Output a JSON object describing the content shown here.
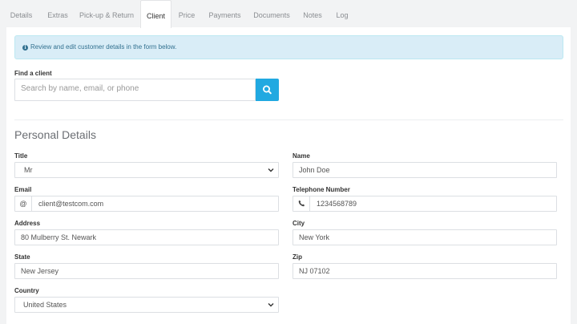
{
  "tabs": [
    {
      "label": "Details",
      "active": false
    },
    {
      "label": "Extras",
      "active": false
    },
    {
      "label": "Pick-up & Return",
      "active": false
    },
    {
      "label": "Client",
      "active": true
    },
    {
      "label": "Price",
      "active": false
    },
    {
      "label": "Payments",
      "active": false
    },
    {
      "label": "Documents",
      "active": false
    },
    {
      "label": "Notes",
      "active": false
    },
    {
      "label": "Log",
      "active": false
    }
  ],
  "alert": {
    "icon": "info-circle-icon",
    "text": "Review and edit customer details in the form below."
  },
  "find_client": {
    "label": "Find a client",
    "placeholder": "Search by name, email, or phone",
    "button_icon": "search-icon"
  },
  "personal_details": {
    "title": "Personal Details",
    "title_field": {
      "label": "Title",
      "value": "Mr"
    },
    "name": {
      "label": "Name",
      "value": "John Doe"
    },
    "email": {
      "label": "Email",
      "addon": "@",
      "value": "client@testcom.com"
    },
    "telephone": {
      "label": "Telephone Number",
      "addon_icon": "phone-icon",
      "value": "1234568789"
    },
    "address": {
      "label": "Address",
      "value": "80 Mulberry St. Newark"
    },
    "city": {
      "label": "City",
      "value": "New York"
    },
    "state": {
      "label": "State",
      "value": "New Jersey"
    },
    "zip": {
      "label": "Zip",
      "value": "NJ 07102"
    },
    "country": {
      "label": "Country",
      "value": "United States"
    }
  },
  "colors": {
    "accent": "#21a9e1",
    "alert_bg": "#d9edf7",
    "alert_text": "#31708f",
    "page_bg": "#f2f3f4"
  }
}
